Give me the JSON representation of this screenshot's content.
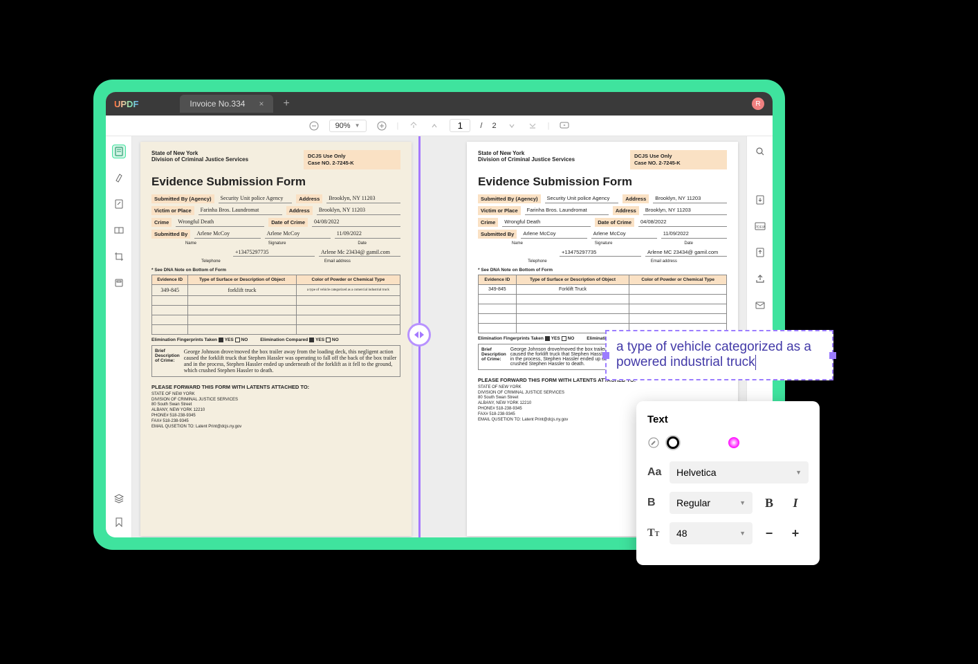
{
  "titlebar": {
    "logo": "UPDF",
    "tab": "Invoice No.334",
    "avatar": "R"
  },
  "toolbar": {
    "zoom": "90%",
    "page_current": "1",
    "page_sep": "/",
    "page_total": "2"
  },
  "doc": {
    "state": "State of New York",
    "division": "Division of Criminal Justice Services",
    "dcjs_line1": "DCJS Use Only",
    "dcjs_line2": "Case NO.  2-7245-K",
    "title": "Evidence Submission Form",
    "labels": {
      "submitted_by_agency": "Submitted By (Agency)",
      "address": "Address",
      "victim_or_place": "Victim or Place",
      "crime": "Crime",
      "date_of_crime": "Date of Crime",
      "submitted_by": "Submitted By",
      "name": "Name",
      "signature": "Signature",
      "date": "Date",
      "telephone": "Telephone",
      "email": "Email address"
    },
    "clean": {
      "agency": "Security Unit police Agency",
      "addr1": "Brooklyn, NY 11203",
      "victim": "Farinha Bros. Laundromat",
      "addr2": "Brooklyn, NY 11203",
      "crime": "Wrongful Death",
      "doc_date": "04/08/2022",
      "sub_name": "Arlene McCoy",
      "sub_sig": "Arlene McCoy",
      "sub_date": "11/09/2022",
      "telephone": "+13475297735",
      "email": "Arlene MC 23434@ gamil.com"
    },
    "hand": {
      "agency": "Security Unit police Agency",
      "addr1": "Brooklyn, NY 11203",
      "victim": "Farinha Bros. Laundromat",
      "addr2": "Brooklyn, NY 11203",
      "crime": "Wrongful Death",
      "doc_date": "04/08/2022",
      "sub_name": "Arlene McCoy",
      "sub_sig": "Arlene McCoy",
      "sub_date": "11/09/2022",
      "telephone": "+13475297735",
      "email": "Arlene Mc 23434@ gamil.com"
    },
    "note": "* See DNA Note on Bottom of Form",
    "table": {
      "h1": "Evidence ID",
      "h2": "Type of Surface or Description of Object",
      "h3": "Color of Powder or Chemical Type",
      "row": {
        "id": "349-845",
        "obj_clean": "Forklift Truck",
        "obj_hand": "forklift truck",
        "chem_hand": "a type of vehicle categorized as a comercial industrial truck"
      }
    },
    "elim": {
      "taken": "Elimination Fingerprints Taken",
      "yes": "YES",
      "no": "NO",
      "compared": "Elimination Compared"
    },
    "desc_label": "Brief Description of Crime:",
    "desc_hand": "George Johnson drove/moved the box trailer away from the loading deck, this negligent action caused the forklift truck that Stephen Hassler was operating to fall off the back of the box trailer and in the process, Stephen Hassler ended up underneath of the forklift as it fell to the ground, which crushed Stephen Hassler to death.",
    "desc_clean": "George Johnson drove/moved the box trailer away from the loading deck, this negligent action caused the forklift truck that Stephen Hassler was operating to fall off the back of the box trailer and in the process, Stephen Hassler ended up underneath of the forklift as it fell to the ground, which crushed Stephen Hassler to death.",
    "forward": "PLEASE FORWARD THIS FORM WITH LATENTS ATTACHED TO:",
    "addr_lines": [
      "STATE OF NEW YORK",
      "DIVISION OF CRIMINAL JUSTICE SERVICES",
      "80 South Swan Street",
      "ALBANY, NEW YORK 12210",
      "PHONE# 518-238-9345",
      "FAX# 518-238-9345",
      "EMAIL QUSETION TO: Latent Print@dcjs.ny.gov"
    ]
  },
  "callout": {
    "text": "a type of vehicle categorized as a powered industrial truck"
  },
  "panel": {
    "title": "Text",
    "font": "Helvetica",
    "weight": "Regular",
    "size": "48",
    "colors": [
      "#000000",
      "#ff3b3b",
      "#ffd54a",
      "#3fd9b8",
      "#4a7dff",
      "#b892ff"
    ]
  }
}
